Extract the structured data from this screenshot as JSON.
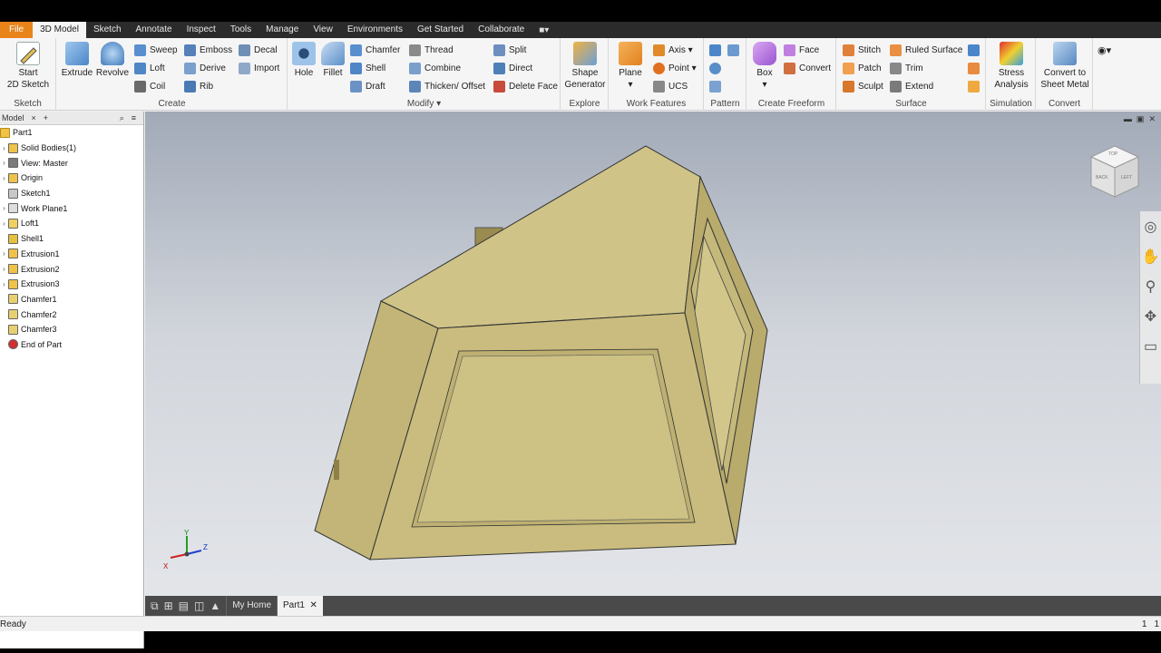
{
  "tabs": {
    "file": "File",
    "items": [
      "3D Model",
      "Sketch",
      "Annotate",
      "Inspect",
      "Tools",
      "Manage",
      "View",
      "Environments",
      "Get Started",
      "Collaborate"
    ],
    "active_index": 0
  },
  "ribbon": {
    "sketch": {
      "start_line1": "Start",
      "start_line2": "2D Sketch",
      "title": "Sketch"
    },
    "create": {
      "extrude": "Extrude",
      "revolve": "Revolve",
      "sweep": "Sweep",
      "loft": "Loft",
      "coil": "Coil",
      "emboss": "Emboss",
      "derive": "Derive",
      "rib": "Rib",
      "decal": "Decal",
      "import": "Import",
      "title": "Create"
    },
    "modify": {
      "hole": "Hole",
      "fillet": "Fillet",
      "chamfer": "Chamfer",
      "shell": "Shell",
      "draft": "Draft",
      "thread": "Thread",
      "combine": "Combine",
      "thicken": "Thicken/ Offset",
      "split": "Split",
      "direct": "Direct",
      "delete_face": "Delete Face",
      "title": "Modify"
    },
    "explore": {
      "shape_line1": "Shape",
      "shape_line2": "Generator",
      "title": "Explore"
    },
    "work": {
      "plane": "Plane",
      "axis": "Axis",
      "point": "Point",
      "ucs": "UCS",
      "title": "Work Features"
    },
    "pattern": {
      "title": "Pattern"
    },
    "freeform": {
      "box": "Box",
      "face": "Face",
      "convert": "Convert",
      "title": "Create Freeform"
    },
    "surface": {
      "stitch": "Stitch",
      "patch": "Patch",
      "sculpt": "Sculpt",
      "ruled": "Ruled Surface",
      "trim": "Trim",
      "extend": "Extend",
      "title": "Surface"
    },
    "simulation": {
      "line1": "Stress",
      "line2": "Analysis",
      "title": "Simulation"
    },
    "convert": {
      "line1": "Convert to",
      "line2": "Sheet Metal",
      "title": "Convert"
    }
  },
  "browser": {
    "tab_label": "Model",
    "root": "Part1",
    "items": [
      {
        "label": "Solid Bodies(1)",
        "expand": true
      },
      {
        "label": "View: Master",
        "expand": true
      },
      {
        "label": "Origin",
        "expand": true
      },
      {
        "label": "Sketch1",
        "expand": false
      },
      {
        "label": "Work Plane1",
        "expand": true
      },
      {
        "label": "Loft1",
        "expand": true
      },
      {
        "label": "Shell1",
        "expand": false
      },
      {
        "label": "Extrusion1",
        "expand": true
      },
      {
        "label": "Extrusion2",
        "expand": true
      },
      {
        "label": "Extrusion3",
        "expand": true
      },
      {
        "label": "Chamfer1",
        "expand": false
      },
      {
        "label": "Chamfer2",
        "expand": false
      },
      {
        "label": "Chamfer3",
        "expand": false
      },
      {
        "label": "End of Part",
        "expand": false
      }
    ]
  },
  "viewcube": {
    "top": "TOP",
    "back": "BACK",
    "left": "LEFT"
  },
  "triad": {
    "x": "X",
    "y": "Y",
    "z": "Z"
  },
  "doc_tabs": {
    "home": "My Home",
    "part": "Part1"
  },
  "status": {
    "text": "Ready",
    "right1": "1",
    "right2": "1"
  },
  "colors": {
    "file_tab": "#e8841a",
    "part_face": "#c9bc7e"
  }
}
